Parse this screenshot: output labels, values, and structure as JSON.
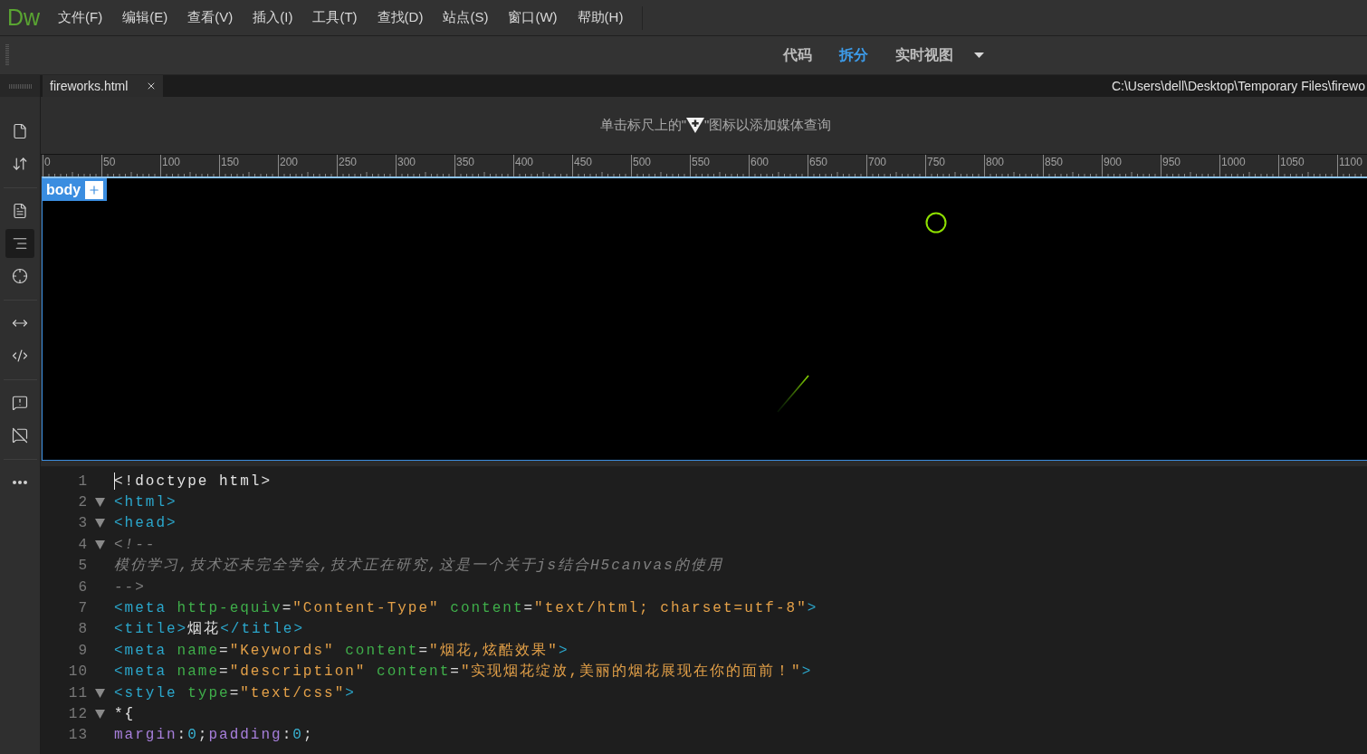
{
  "menu_bar": {
    "logo": "Dw",
    "items": [
      "文件(F)",
      "编辑(E)",
      "查看(V)",
      "插入(I)",
      "工具(T)",
      "查找(D)",
      "站点(S)",
      "窗口(W)",
      "帮助(H)"
    ]
  },
  "view_switcher": {
    "modes": [
      {
        "label": "代码",
        "selected": false
      },
      {
        "label": "拆分",
        "selected": true
      },
      {
        "label": "实时视图",
        "selected": false
      }
    ]
  },
  "side_toolbar": [
    {
      "tools": [
        {
          "selected": false
        },
        {
          "selected": false
        }
      ]
    },
    {
      "tools": [
        {
          "selected": false
        },
        {
          "selected": true
        },
        {
          "selected": false
        }
      ]
    },
    {
      "tools": [
        {
          "selected": false
        },
        {
          "selected": false
        }
      ]
    },
    {
      "tools": [
        {
          "selected": false
        },
        {
          "selected": false
        }
      ]
    },
    {
      "tools": [
        {
          "selected": false
        }
      ]
    }
  ],
  "document_tabs": [
    {
      "label": "fireworks.html",
      "selected": true
    }
  ],
  "file_path": "C:\\Users\\dell\\Desktop\\Temporary Files\\firewo",
  "media_query_hint": {
    "before_icon": "单击标尺上的\"",
    "after_icon": "\"图标以添加媒体查询"
  },
  "ruler": {
    "labels": [
      "0",
      "50",
      "100",
      "150",
      "200",
      "250",
      "300",
      "350",
      "400",
      "450",
      "500",
      "550",
      "600",
      "650",
      "700",
      "750",
      "800",
      "850",
      "900",
      "950",
      "1000",
      "1050",
      "1100"
    ]
  },
  "design_view": {
    "element_tag": "body"
  },
  "code_view": {
    "lines": [
      {
        "number": "1",
        "foldable": false,
        "cursor": true,
        "tokens": [
          {
            "kind": "plain",
            "text": "<!doctype html>"
          }
        ]
      },
      {
        "number": "2",
        "foldable": true,
        "cursor": false,
        "tokens": [
          {
            "kind": "tag",
            "text": "<html>"
          }
        ]
      },
      {
        "number": "3",
        "foldable": true,
        "cursor": false,
        "tokens": [
          {
            "kind": "tag",
            "text": "<head>"
          }
        ]
      },
      {
        "number": "4",
        "foldable": true,
        "cursor": false,
        "tokens": [
          {
            "kind": "comment",
            "text": "<!--"
          }
        ]
      },
      {
        "number": "5",
        "foldable": false,
        "cursor": false,
        "tokens": [
          {
            "kind": "comment",
            "text": "模仿学习,技术还未完全学会,技术正在研究,这是一个关于js结合H5canvas的使用"
          }
        ]
      },
      {
        "number": "6",
        "foldable": false,
        "cursor": false,
        "tokens": [
          {
            "kind": "comment",
            "text": "-->"
          }
        ]
      },
      {
        "number": "7",
        "foldable": false,
        "cursor": false,
        "tokens": [
          {
            "kind": "tag",
            "text": "<meta"
          },
          {
            "kind": "attr",
            "text": " http-equiv"
          },
          {
            "kind": "punct",
            "text": "="
          },
          {
            "kind": "string",
            "text": "\"Content-Type\""
          },
          {
            "kind": "attr",
            "text": " content"
          },
          {
            "kind": "punct",
            "text": "="
          },
          {
            "kind": "string",
            "text": "\"text/html; charset=utf-8\""
          },
          {
            "kind": "tag",
            "text": ">"
          }
        ]
      },
      {
        "number": "8",
        "foldable": false,
        "cursor": false,
        "tokens": [
          {
            "kind": "tag",
            "text": "<title>"
          },
          {
            "kind": "plain",
            "text": "烟花"
          },
          {
            "kind": "tag",
            "text": "</title>"
          }
        ]
      },
      {
        "number": "9",
        "foldable": false,
        "cursor": false,
        "tokens": [
          {
            "kind": "tag",
            "text": "<meta"
          },
          {
            "kind": "attr",
            "text": " name"
          },
          {
            "kind": "punct",
            "text": "="
          },
          {
            "kind": "string",
            "text": "\"Keywords\""
          },
          {
            "kind": "attr",
            "text": " content"
          },
          {
            "kind": "punct",
            "text": "="
          },
          {
            "kind": "string",
            "text": "\"烟花,炫酷效果\""
          },
          {
            "kind": "tag",
            "text": ">"
          }
        ]
      },
      {
        "number": "10",
        "foldable": false,
        "cursor": false,
        "tokens": [
          {
            "kind": "tag",
            "text": "<meta"
          },
          {
            "kind": "attr",
            "text": " name"
          },
          {
            "kind": "punct",
            "text": "="
          },
          {
            "kind": "string",
            "text": "\"description\""
          },
          {
            "kind": "attr",
            "text": " content"
          },
          {
            "kind": "punct",
            "text": "="
          },
          {
            "kind": "string",
            "text": "\"实现烟花绽放,美丽的烟花展现在你的面前！\""
          },
          {
            "kind": "tag",
            "text": ">"
          }
        ]
      },
      {
        "number": "11",
        "foldable": true,
        "cursor": false,
        "tokens": [
          {
            "kind": "tag",
            "text": "<style"
          },
          {
            "kind": "attr",
            "text": " type"
          },
          {
            "kind": "punct",
            "text": "="
          },
          {
            "kind": "string",
            "text": "\"text/css\""
          },
          {
            "kind": "tag",
            "text": ">"
          }
        ]
      },
      {
        "number": "12",
        "foldable": true,
        "cursor": false,
        "tokens": [
          {
            "kind": "plain",
            "text": "*{"
          }
        ]
      },
      {
        "number": "13",
        "foldable": false,
        "cursor": false,
        "tokens": [
          {
            "kind": "prop",
            "text": "margin"
          },
          {
            "kind": "punct",
            "text": ":"
          },
          {
            "kind": "number",
            "text": "0"
          },
          {
            "kind": "punct",
            "text": ";"
          },
          {
            "kind": "prop",
            "text": "padding"
          },
          {
            "kind": "punct",
            "text": ":"
          },
          {
            "kind": "number",
            "text": "0"
          },
          {
            "kind": "punct",
            "text": ";"
          }
        ]
      }
    ]
  }
}
